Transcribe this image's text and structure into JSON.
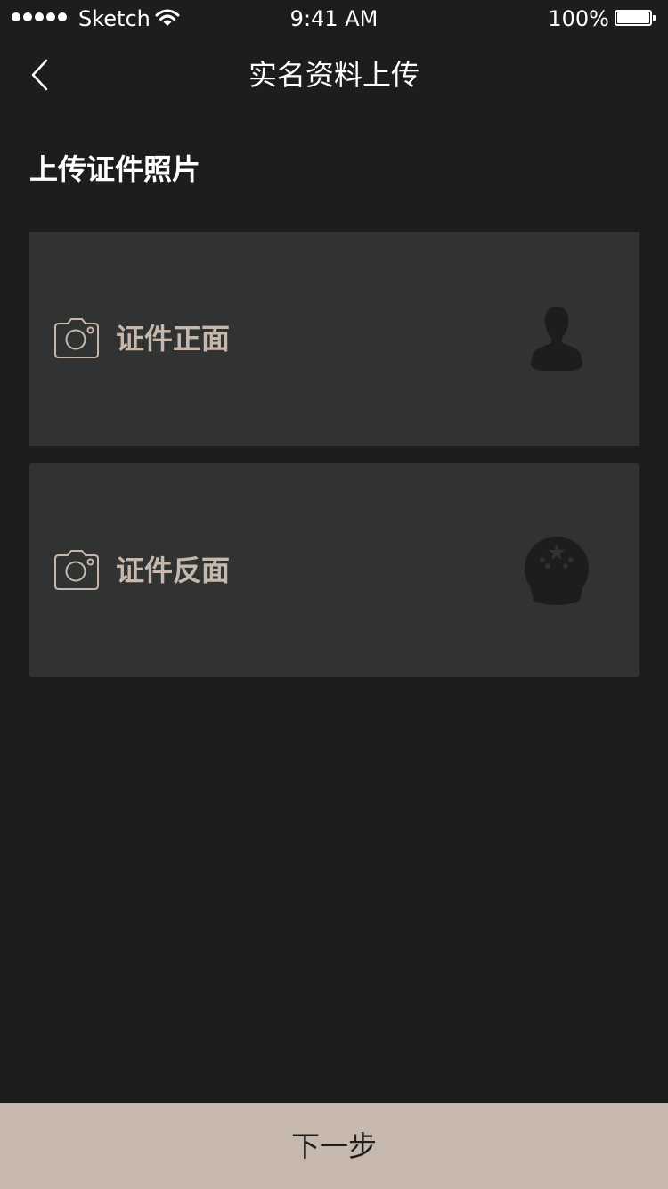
{
  "status_bar": {
    "carrier": "Sketch",
    "time": "9:41 AM",
    "battery": "100%"
  },
  "nav": {
    "title": "实名资料上传",
    "back_icon": "chevron-left-icon"
  },
  "section": {
    "title": "上传证件照片"
  },
  "cards": [
    {
      "label": "证件正面",
      "icon": "camera-icon",
      "illustration": "person-silhouette-icon"
    },
    {
      "label": "证件反面",
      "icon": "camera-icon",
      "illustration": "national-emblem-icon"
    }
  ],
  "next": {
    "label": "下一步"
  },
  "colors": {
    "background": "#1c1d1d",
    "card": "#313232",
    "accent": "#c7b8ad",
    "text": "#ffffff"
  }
}
